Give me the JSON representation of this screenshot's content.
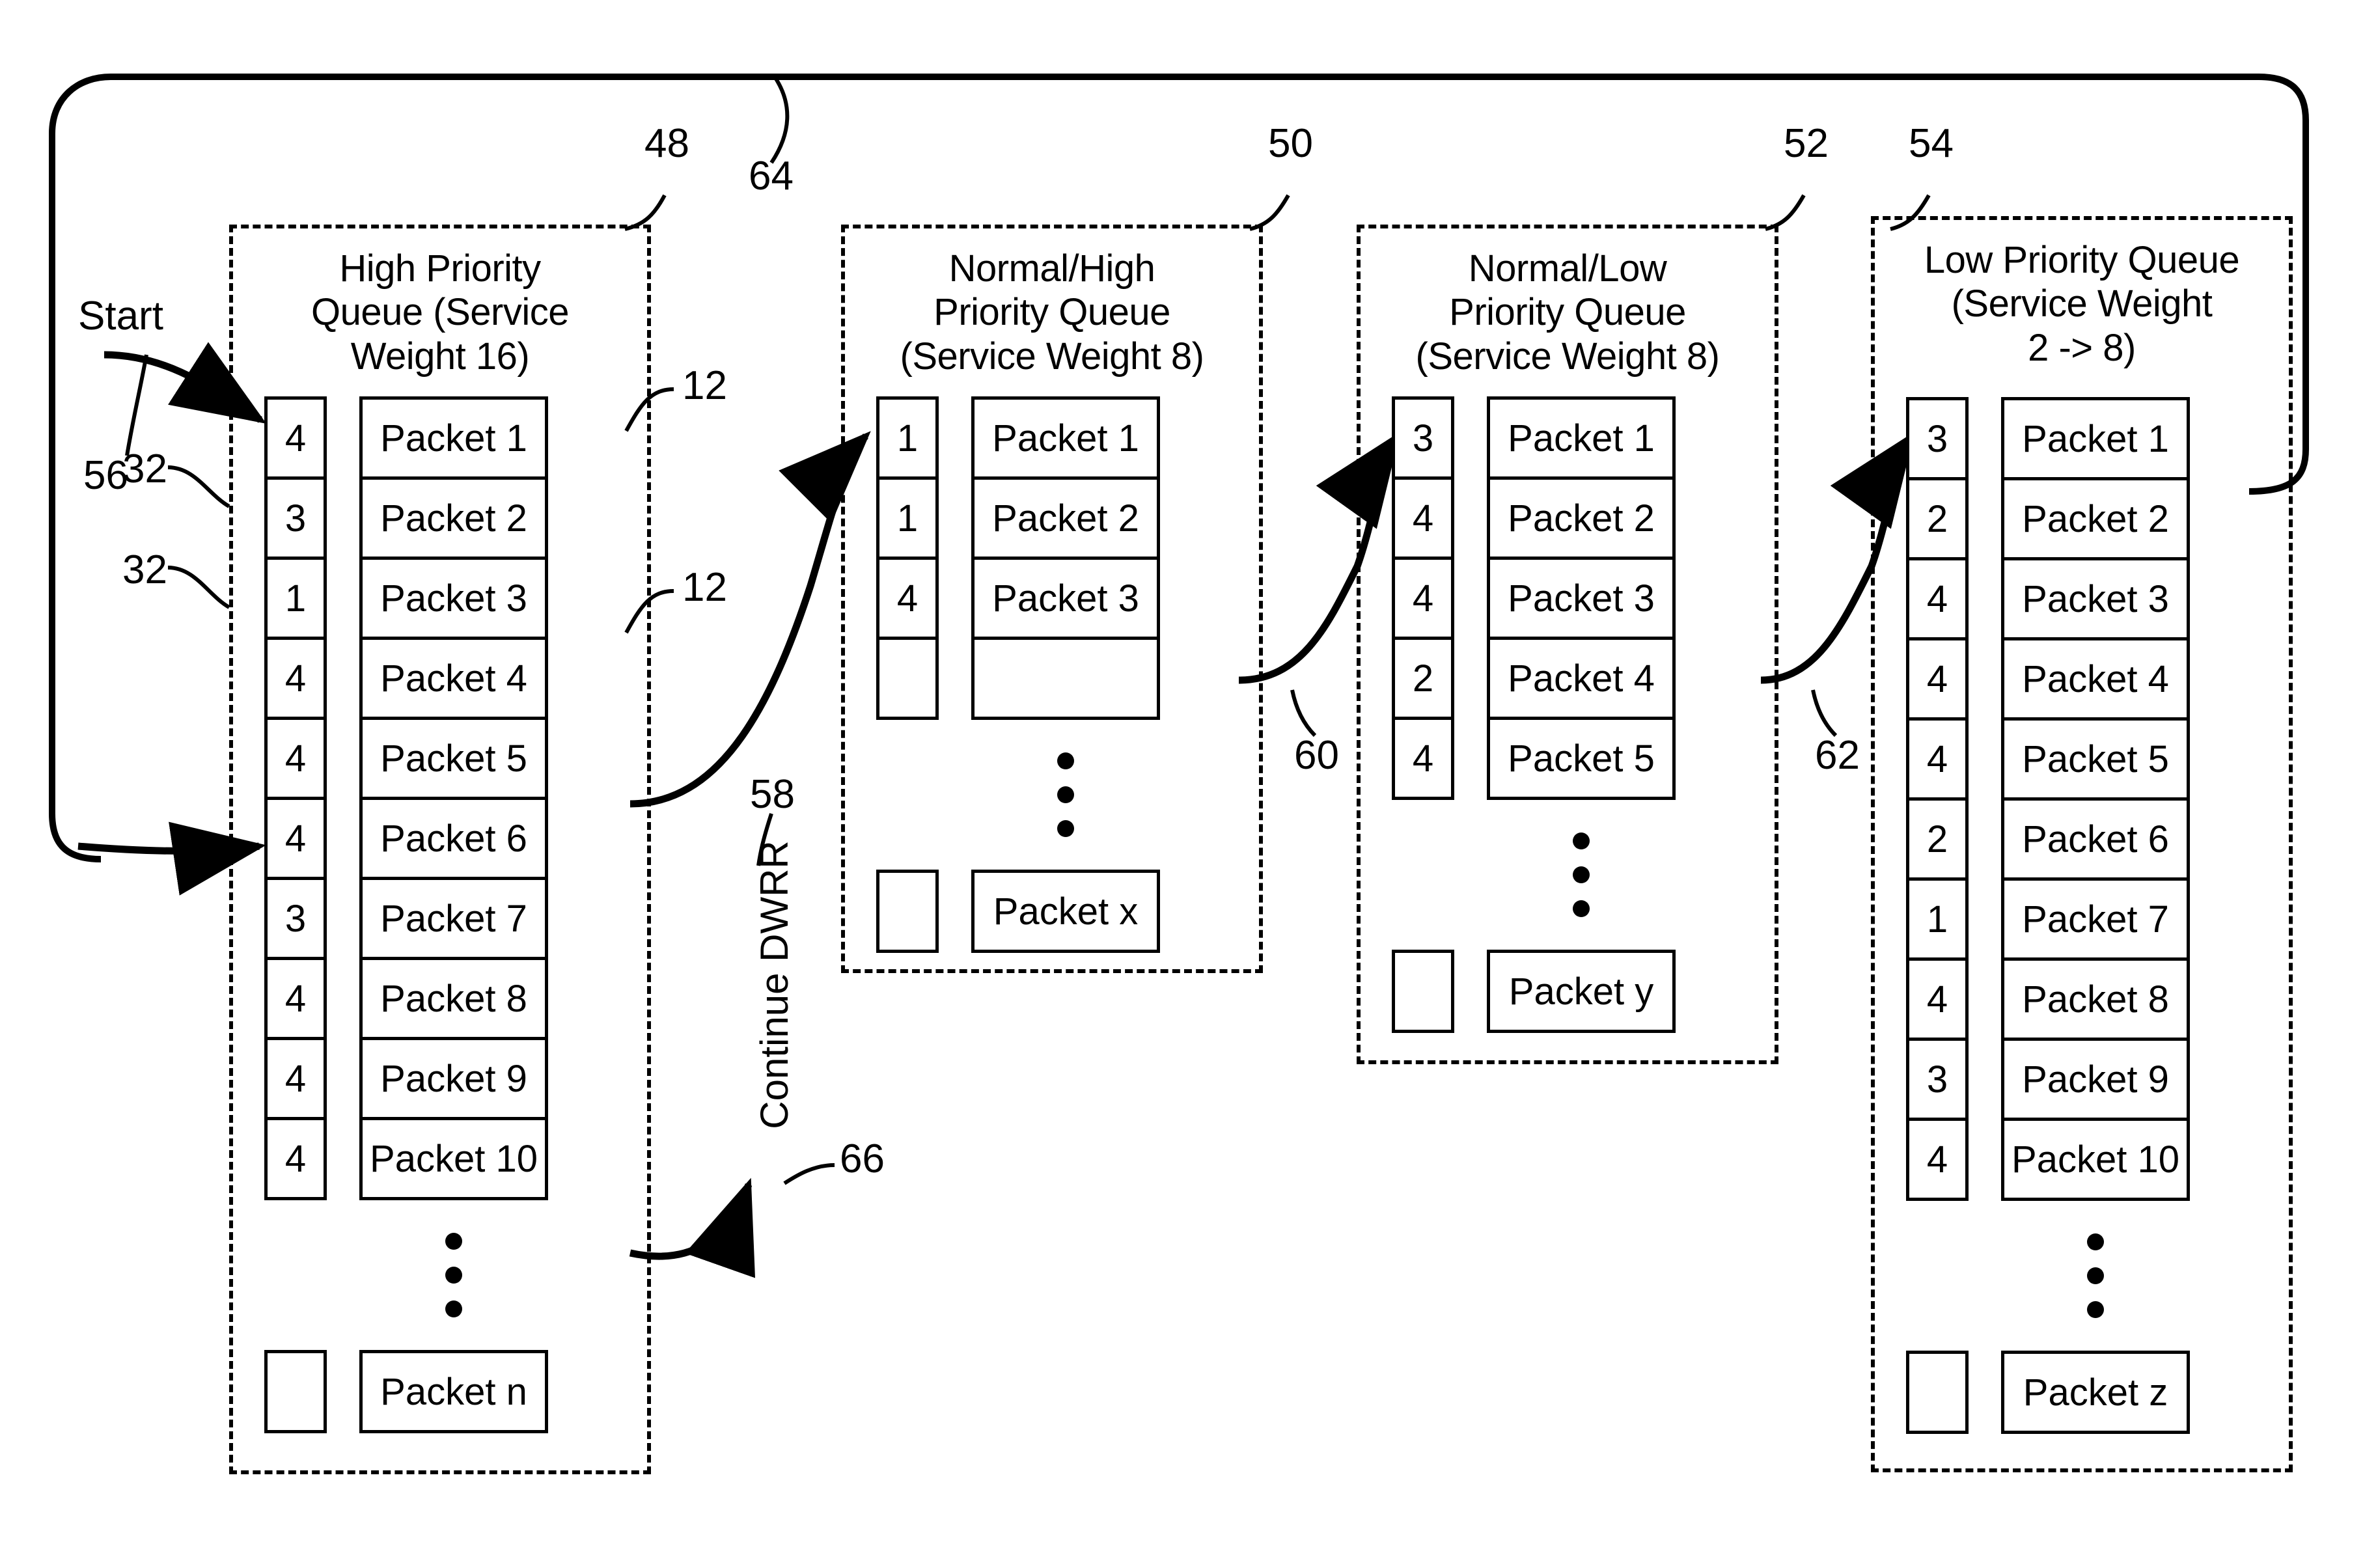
{
  "figure": {
    "labels": {
      "start": "Start",
      "continue_dwrr": "Continue DWRR",
      "ref_56": "56",
      "ref_32_a": "32",
      "ref_32_b": "32",
      "ref_48": "48",
      "ref_64": "64",
      "ref_50": "50",
      "ref_52": "52",
      "ref_54": "54",
      "ref_12_a": "12",
      "ref_12_b": "12",
      "ref_58": "58",
      "ref_60": "60",
      "ref_62": "62",
      "ref_66": "66"
    },
    "queues": [
      {
        "id": "high-priority-queue",
        "title": "High Priority\nQueue (Service\nWeight 16)",
        "title_lines": [
          "High Priority",
          "Queue (Service",
          "Weight 16)"
        ],
        "service_weight": "16",
        "rows": [
          {
            "credit": "4",
            "packet": "Packet 1"
          },
          {
            "credit": "3",
            "packet": "Packet 2"
          },
          {
            "credit": "1",
            "packet": "Packet 3"
          },
          {
            "credit": "4",
            "packet": "Packet 4"
          },
          {
            "credit": "4",
            "packet": "Packet 5"
          },
          {
            "credit": "4",
            "packet": "Packet 6"
          },
          {
            "credit": "3",
            "packet": "Packet 7"
          },
          {
            "credit": "4",
            "packet": "Packet 8"
          },
          {
            "credit": "4",
            "packet": "Packet 9"
          },
          {
            "credit": "4",
            "packet": "Packet 10"
          }
        ],
        "tail": {
          "credit": "",
          "packet": "Packet n"
        }
      },
      {
        "id": "normal-high-priority-queue",
        "title": "Normal/High\nPriority Queue\n(Service Weight 8)",
        "title_lines": [
          "Normal/High",
          "Priority Queue",
          "(Service Weight 8)"
        ],
        "service_weight": "8",
        "rows": [
          {
            "credit": "1",
            "packet": "Packet 1"
          },
          {
            "credit": "1",
            "packet": "Packet 2"
          },
          {
            "credit": "4",
            "packet": "Packet 3"
          },
          {
            "credit": "",
            "packet": ""
          }
        ],
        "tail": {
          "credit": "",
          "packet": "Packet x"
        }
      },
      {
        "id": "normal-low-priority-queue",
        "title": "Normal/Low\nPriority Queue\n(Service Weight 8)",
        "title_lines": [
          "Normal/Low",
          "Priority Queue",
          "(Service Weight 8)"
        ],
        "service_weight": "8",
        "rows": [
          {
            "credit": "3",
            "packet": "Packet 1"
          },
          {
            "credit": "4",
            "packet": "Packet 2"
          },
          {
            "credit": "4",
            "packet": "Packet 3"
          },
          {
            "credit": "2",
            "packet": "Packet 4"
          },
          {
            "credit": "4",
            "packet": "Packet 5"
          }
        ],
        "tail": {
          "credit": "",
          "packet": "Packet y"
        }
      },
      {
        "id": "low-priority-queue",
        "title": "Low Priority Queue\n(Service Weight\n2 -> 8)",
        "title_lines": [
          "Low Priority Queue",
          "(Service Weight",
          "2 -> 8)"
        ],
        "service_weight": "2 -> 8",
        "rows": [
          {
            "credit": "3",
            "packet": "Packet 1"
          },
          {
            "credit": "2",
            "packet": "Packet 2"
          },
          {
            "credit": "4",
            "packet": "Packet 3"
          },
          {
            "credit": "4",
            "packet": "Packet 4"
          },
          {
            "credit": "4",
            "packet": "Packet 5"
          },
          {
            "credit": "2",
            "packet": "Packet 6"
          },
          {
            "credit": "1",
            "packet": "Packet 7"
          },
          {
            "credit": "4",
            "packet": "Packet 8"
          },
          {
            "credit": "3",
            "packet": "Packet 9"
          },
          {
            "credit": "4",
            "packet": "Packet 10"
          }
        ],
        "tail": {
          "credit": "",
          "packet": "Packet z"
        }
      }
    ]
  }
}
